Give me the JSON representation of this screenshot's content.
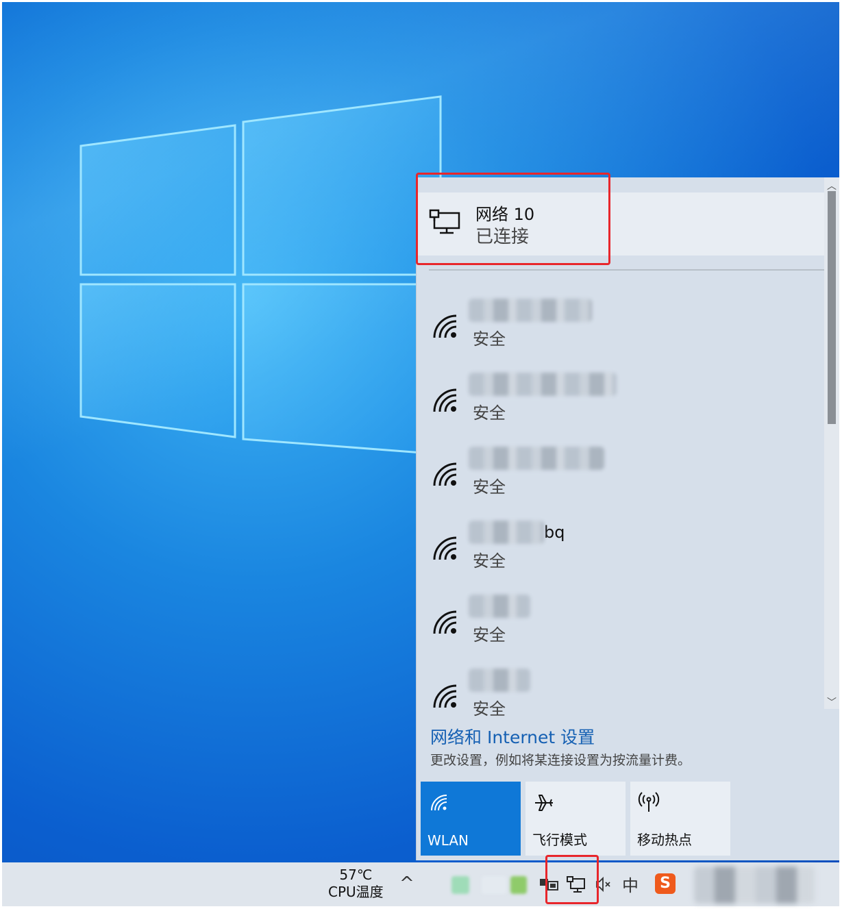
{
  "flyout": {
    "connected": {
      "name": "网络 10",
      "status": "已连接",
      "icon": "ethernet-monitor-icon"
    },
    "wifi_networks": [
      {
        "name_visible": "",
        "security": "安全",
        "icon": "wifi-secured-icon"
      },
      {
        "name_visible": "",
        "security": "安全",
        "icon": "wifi-secured-icon"
      },
      {
        "name_visible": "",
        "security": "安全",
        "icon": "wifi-secured-icon"
      },
      {
        "name_visible": "bq",
        "security": "安全",
        "icon": "wifi-secured-icon"
      },
      {
        "name_visible": "",
        "security": "安全",
        "icon": "wifi-secured-icon"
      },
      {
        "name_visible": "",
        "security": "安全",
        "icon": "wifi-secured-icon"
      }
    ],
    "settings_link": "网络和 Internet 设置",
    "settings_desc": "更改设置，例如将某连接设置为按流量计费。",
    "quick_actions": [
      {
        "label": "WLAN",
        "icon": "wifi-icon",
        "active": true
      },
      {
        "label": "飞行模式",
        "icon": "airplane-icon",
        "active": false
      },
      {
        "label": "移动热点",
        "icon": "hotspot-icon",
        "active": false
      }
    ]
  },
  "taskbar": {
    "temperature": "57℃",
    "temperature_label": "CPU温度",
    "chevron": "^",
    "ime": "中",
    "sogou": "S"
  },
  "colors": {
    "accent": "#0f78d7",
    "highlight": "#e8262b",
    "link": "#1560b3"
  }
}
